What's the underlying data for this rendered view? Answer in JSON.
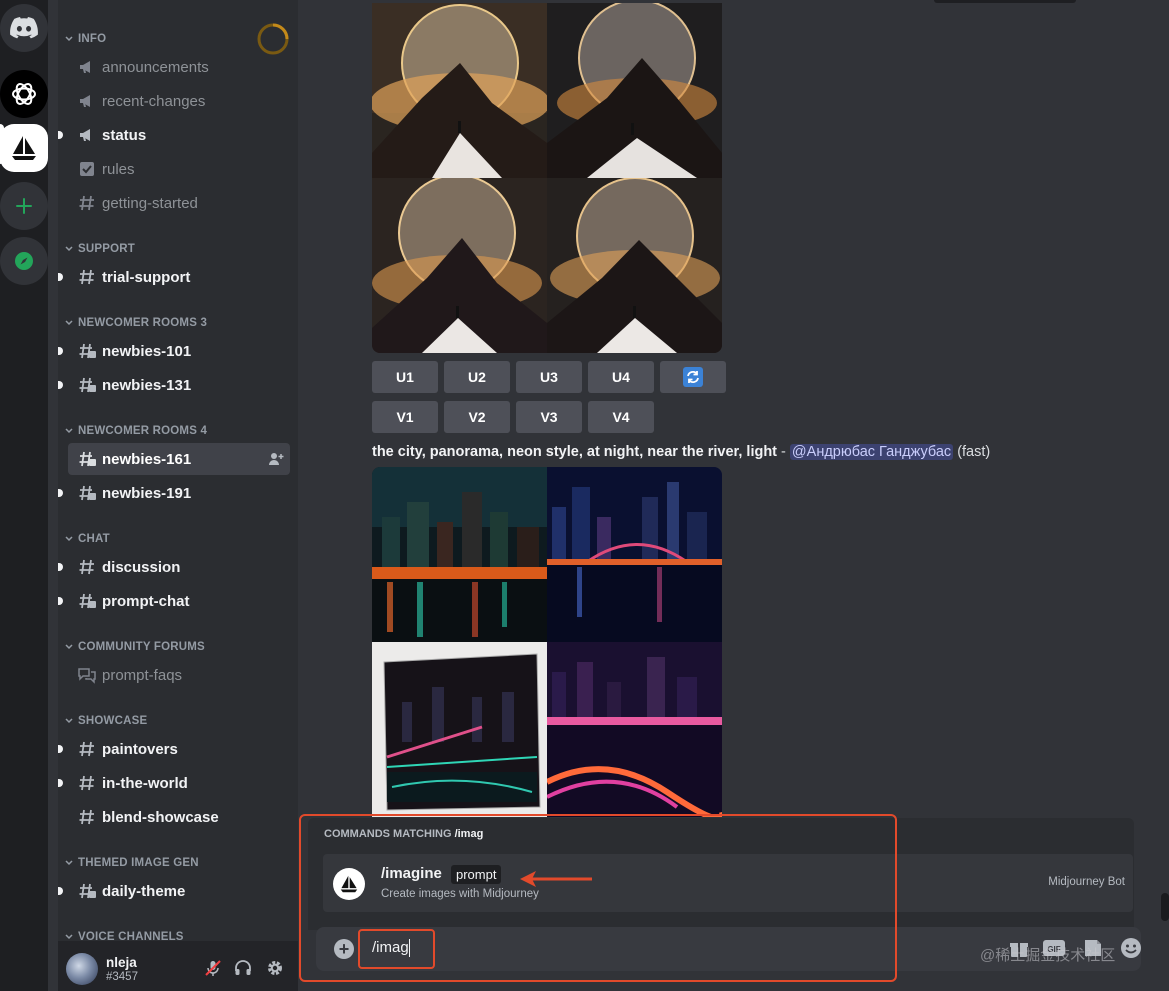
{
  "sidebar": {
    "categories": {
      "info": "INFO",
      "support": "SUPPORT",
      "newcomer3": "NEWCOMER ROOMS 3",
      "newcomer4": "NEWCOMER ROOMS 4",
      "chat": "CHAT",
      "forums": "COMMUNITY FORUMS",
      "showcase": "SHOWCASE",
      "themed": "THEMED IMAGE GEN",
      "voice": "VOICE CHANNELS"
    },
    "channels": {
      "announcements": "announcements",
      "recent_changes": "recent-changes",
      "status": "status",
      "rules": "rules",
      "getting_started": "getting-started",
      "trial_support": "trial-support",
      "newbies_101": "newbies-101",
      "newbies_131": "newbies-131",
      "newbies_161": "newbies-161",
      "newbies_191": "newbies-191",
      "discussion": "discussion",
      "prompt_chat": "prompt-chat",
      "prompt_faqs": "prompt-faqs",
      "paintovers": "paintovers",
      "in_the_world": "in-the-world",
      "blend_showcase": "blend-showcase",
      "daily_theme": "daily-theme"
    }
  },
  "user": {
    "name": "nleja",
    "tag": "#3457"
  },
  "buttons": {
    "upscale": [
      "U1",
      "U2",
      "U3",
      "U4"
    ],
    "variation": [
      "V1",
      "V2",
      "V3",
      "V4"
    ]
  },
  "message": {
    "prompt": "the city, panorama, neon style, at night, near the river, light",
    "separator": " - ",
    "mention": "@Андрюбас Ганджубас",
    "speed": "(fast)"
  },
  "popup": {
    "header": "COMMANDS MATCHING ",
    "query": "/imag",
    "command": "/imagine",
    "argument": "prompt",
    "description": "Create images with Midjourney",
    "source": "Midjourney Bot"
  },
  "chat_input": {
    "value": "/imag"
  },
  "watermark": "@稀土掘金技术社区",
  "colors": {
    "accent": "#23a55a",
    "annotation": "#e24a2b",
    "mention_bg": "#3c4270"
  }
}
